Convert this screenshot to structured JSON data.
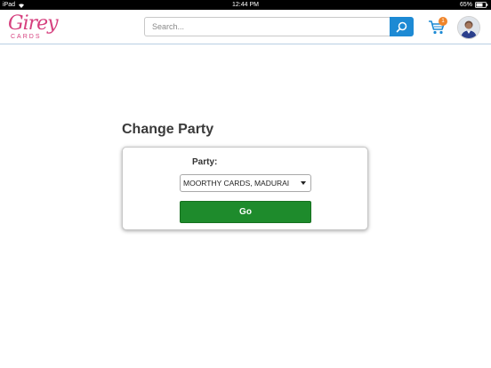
{
  "status_bar": {
    "device": "iPad",
    "time": "12:44 PM",
    "battery": "65%"
  },
  "header": {
    "logo_script": "Girey",
    "logo_sub": "CARDS",
    "search": {
      "placeholder": "Search...",
      "value": ""
    },
    "cart_count": "1",
    "icons": {
      "search": "search-icon",
      "cart": "cart-icon",
      "avatar": "avatar"
    }
  },
  "main": {
    "title": "Change Party",
    "party_label": "Party:",
    "party_selected": "MOORTHY CARDS, MADURAI",
    "go_label": "Go"
  },
  "colors": {
    "brand_pink": "#d6417f",
    "search_blue": "#1d8ad4",
    "go_green": "#1e8b2c",
    "badge_orange": "#f0852b"
  }
}
